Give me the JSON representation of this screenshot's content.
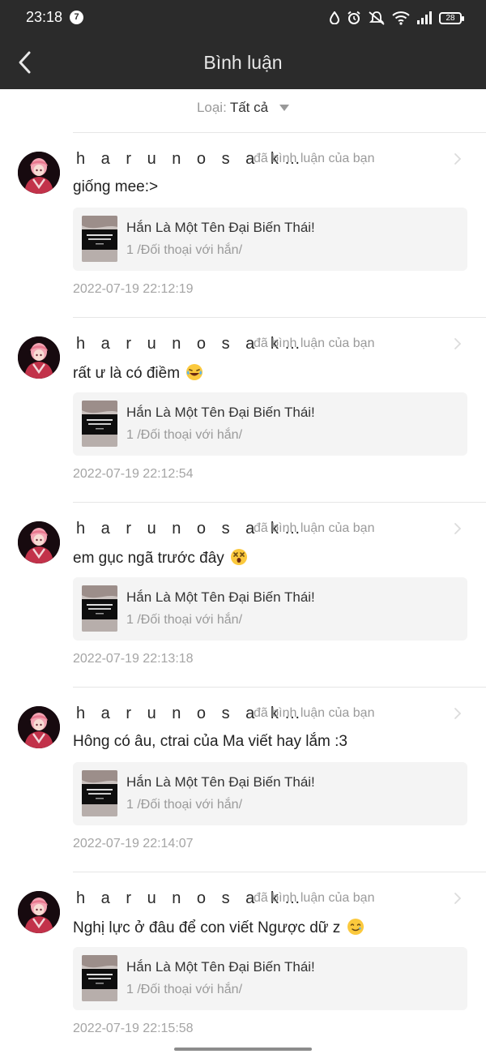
{
  "status_bar": {
    "time": "23:18",
    "notification_count": "7",
    "battery": "28"
  },
  "header": {
    "title": "Bình luận"
  },
  "filter": {
    "label": "Loại:",
    "value": "Tất cả"
  },
  "items": [
    {
      "username": "h a r u n o  s a k…",
      "action": "đã bình luận của bạn",
      "comment": "giống mee:>",
      "emoji": "",
      "card_title": "Hắn Là Một Tên Đại Biến Thái!",
      "card_sub": "1 /Đối thoại với hắn/",
      "timestamp": "2022-07-19 22:12:19"
    },
    {
      "username": "h a r u n o  s a k…",
      "action": "đã bình luận của bạn",
      "comment": "rất ư là có điềm",
      "emoji": "tears-of-joy",
      "card_title": "Hắn Là Một Tên Đại Biến Thái!",
      "card_sub": "1 /Đối thoại với hắn/",
      "timestamp": "2022-07-19 22:12:54"
    },
    {
      "username": "h a r u n o  s a k…",
      "action": "đã bình luận của bạn",
      "comment": "em gục ngã trước đây",
      "emoji": "dizzy-face",
      "card_title": "Hắn Là Một Tên Đại Biến Thái!",
      "card_sub": "1 /Đối thoại với hắn/",
      "timestamp": "2022-07-19 22:13:18"
    },
    {
      "username": "h a r u n o  s a k…",
      "action": "đã bình luận của bạn",
      "comment": "Hông có âu, ctrai của Ma viết hay lắm :3",
      "emoji": "",
      "card_title": "Hắn Là Một Tên Đại Biến Thái!",
      "card_sub": "1 /Đối thoại với hắn/",
      "timestamp": "2022-07-19 22:14:07"
    },
    {
      "username": "h a r u n o  s a k…",
      "action": "đã bình luận của bạn",
      "comment": "Nghị lực ở đâu để con viết Ngược dữ z",
      "emoji": "smiling-tear",
      "card_title": "Hắn Là Một Tên Đại Biến Thái!",
      "card_sub": "1 /Đối thoại với hắn/",
      "timestamp": "2022-07-19 22:15:58"
    }
  ]
}
